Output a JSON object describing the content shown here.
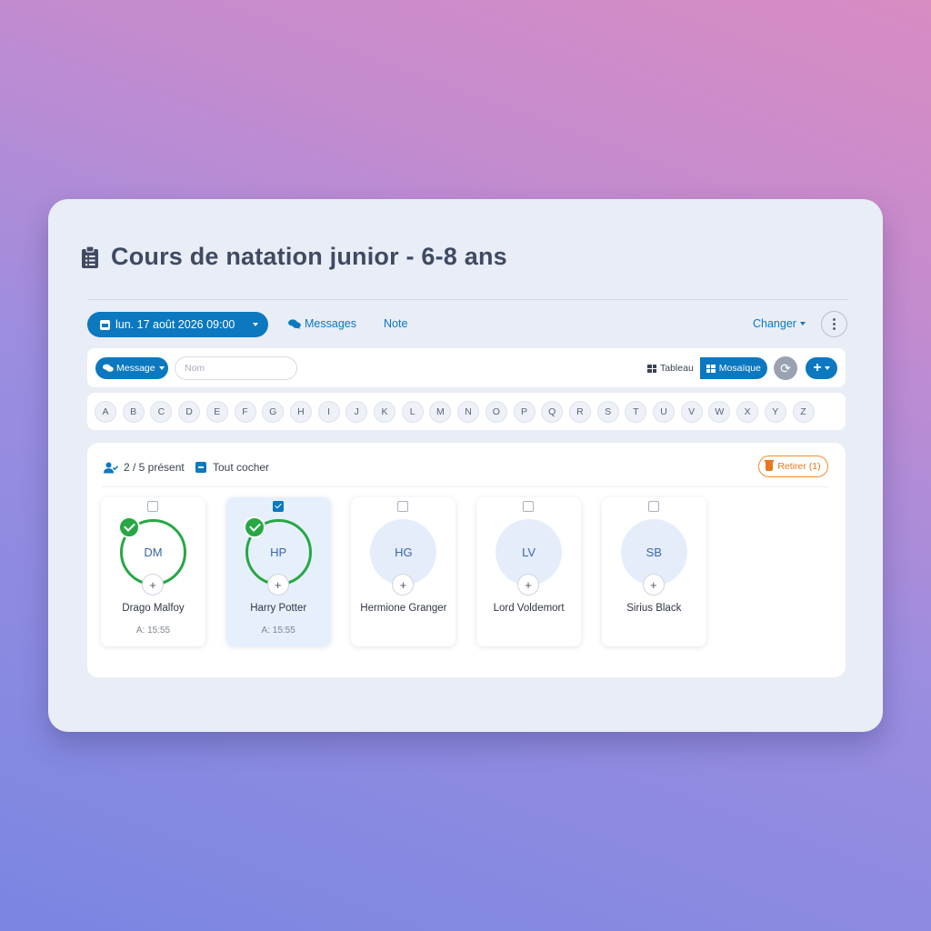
{
  "header": {
    "title": "Cours de natation junior - 6-8 ans",
    "title_icon": "clipboard-list-icon"
  },
  "toolbar": {
    "date_label": "lun. 17 août 2026 09:00",
    "messages_label": "Messages",
    "note_label": "Note",
    "change_label": "Changer"
  },
  "filters": {
    "message_label": "Message",
    "name_placeholder": "Nom",
    "name_value": "",
    "view_table_label": "Tableau",
    "view_mosaic_label": "Mosaïque",
    "active_view": "Mosaïque",
    "add_label": "+"
  },
  "alphabet": [
    "A",
    "B",
    "C",
    "D",
    "E",
    "F",
    "G",
    "H",
    "I",
    "J",
    "K",
    "L",
    "M",
    "N",
    "O",
    "P",
    "Q",
    "R",
    "S",
    "T",
    "U",
    "V",
    "W",
    "X",
    "Y",
    "Z"
  ],
  "attendance": {
    "present_text": "2 / 5 présent",
    "select_all_label": "Tout cocher",
    "remove_label": "Retirer (1)"
  },
  "participants": [
    {
      "initials": "DM",
      "name": "Drago Malfoy",
      "time": "A: 15:55",
      "present": true,
      "selected": false
    },
    {
      "initials": "HP",
      "name": "Harry Potter",
      "time": "A: 15:55",
      "present": true,
      "selected": true
    },
    {
      "initials": "HG",
      "name": "Hermione Granger",
      "time": "",
      "present": false,
      "selected": false
    },
    {
      "initials": "LV",
      "name": "Lord Voldemort",
      "time": "",
      "present": false,
      "selected": false
    },
    {
      "initials": "SB",
      "name": "Sirius Black",
      "time": "",
      "present": false,
      "selected": false
    }
  ],
  "colors": {
    "primary": "#0b78c0",
    "present_green": "#27a745",
    "remove_orange": "#e8781d",
    "card_bg": "#e9edf5"
  }
}
